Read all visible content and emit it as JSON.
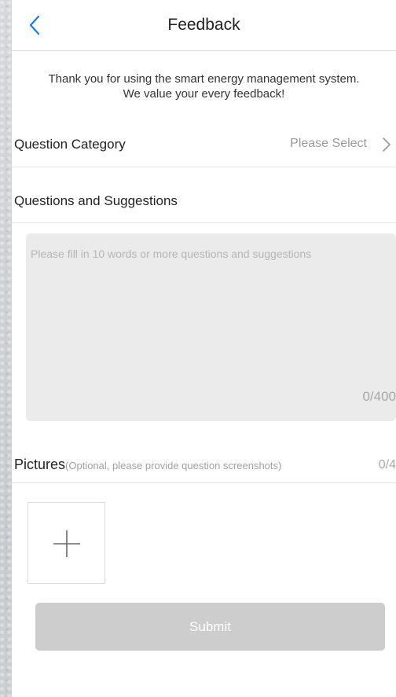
{
  "header": {
    "title": "Feedback",
    "back_icon": "chevron-left-icon",
    "accent_color": "#1b7fe0"
  },
  "intro": {
    "text": "Thank you for using the smart energy management system. We value your every feedback!"
  },
  "category": {
    "label": "Question Category",
    "value": "Please Select",
    "icon": "chevron-right-icon"
  },
  "suggestions": {
    "label": "Questions and Suggestions",
    "placeholder": "Please fill in 10 words or more questions and suggestions",
    "value": "",
    "char_count": "0/400"
  },
  "pictures": {
    "label": "Pictures",
    "hint": "(Optional, please provide question screenshots)",
    "count": "0/4",
    "add_icon": "plus-icon"
  },
  "submit": {
    "label": "Submit",
    "enabled": false
  }
}
